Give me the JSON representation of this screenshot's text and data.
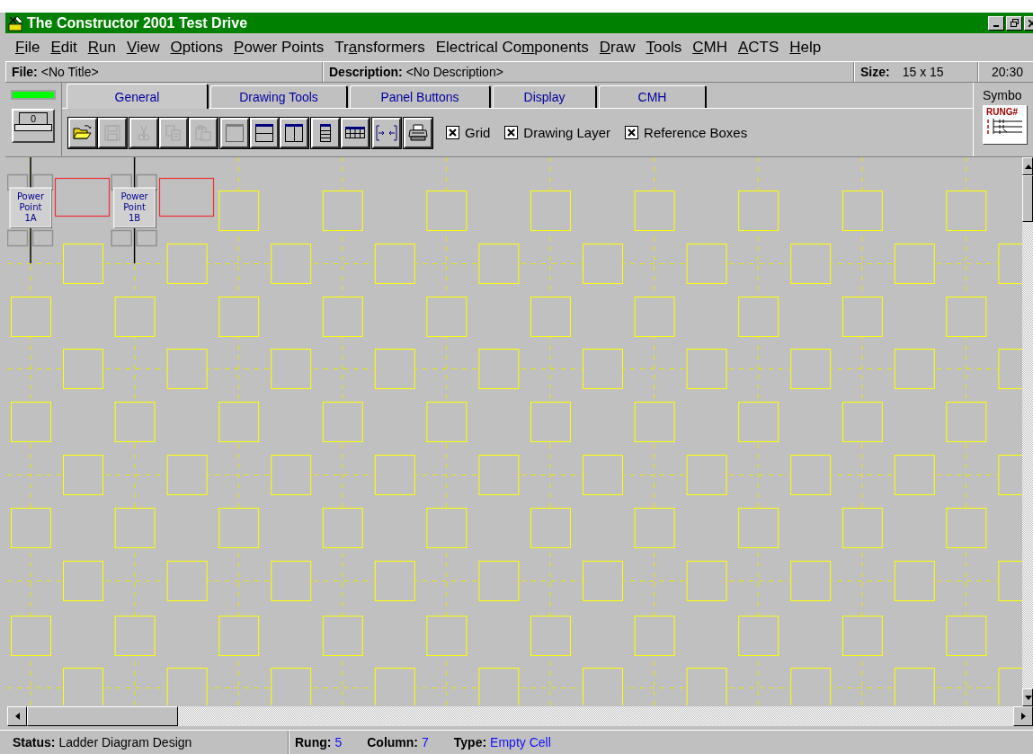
{
  "window": {
    "title": "The Constructor 2001 Test Drive"
  },
  "menu": [
    {
      "key": "F",
      "post": "ile"
    },
    {
      "key": "E",
      "post": "dit"
    },
    {
      "key": "R",
      "post": "un"
    },
    {
      "key": "V",
      "post": "iew"
    },
    {
      "key": "O",
      "post": "ptions"
    },
    {
      "key": "P",
      "post": "ower Points"
    },
    {
      "pre": "Tr",
      "key": "a",
      "post": "nsformers"
    },
    {
      "pre": "Electrical Co",
      "key": "m",
      "post": "ponents"
    },
    {
      "key": "D",
      "post": "raw"
    },
    {
      "key": "T",
      "post": "ools"
    },
    {
      "key": "C",
      "post": "MH"
    },
    {
      "key": "A",
      "post": "CTS"
    },
    {
      "key": "H",
      "post": "elp"
    }
  ],
  "info_bar": {
    "file_label": "File:",
    "file_value": "<No Title>",
    "description_label": "Description:",
    "description_value": "<No Description>",
    "size_label": "Size:",
    "size_value": "15 x 15",
    "time": "20:30"
  },
  "left_panel": {
    "indicator_on": true,
    "counter": "0"
  },
  "tabs": [
    {
      "label": "General",
      "selected": true
    },
    {
      "label": "Drawing Tools",
      "selected": false
    },
    {
      "label": "Panel Buttons",
      "selected": false
    },
    {
      "label": "Display",
      "selected": false
    },
    {
      "label": "CMH",
      "selected": false
    }
  ],
  "toolbar_groups": [
    [
      {
        "kind": "open",
        "disabled": false
      },
      {
        "kind": "save",
        "disabled": true
      }
    ],
    [
      {
        "kind": "cut",
        "disabled": true
      },
      {
        "kind": "copy",
        "disabled": true
      },
      {
        "kind": "paste",
        "disabled": true
      }
    ],
    [
      {
        "kind": "blank",
        "disabled": false
      },
      {
        "kind": "split-h",
        "disabled": false
      },
      {
        "kind": "split-v",
        "disabled": false
      }
    ],
    [
      {
        "kind": "rows",
        "disabled": false
      },
      {
        "kind": "table",
        "disabled": false
      }
    ],
    [
      {
        "kind": "fit",
        "disabled": false
      }
    ],
    [
      {
        "kind": "print",
        "disabled": false
      }
    ]
  ],
  "options": [
    {
      "label": "Grid",
      "checked": true
    },
    {
      "label": "Drawing Layer",
      "checked": true
    },
    {
      "label": "Reference Boxes",
      "checked": true
    }
  ],
  "symbols_panel": {
    "title": "Symbo",
    "icon_label": "RUNG#"
  },
  "canvas": {
    "power_points": [
      {
        "label": "Power Point 1A"
      },
      {
        "label": "Power Point 1B"
      }
    ]
  },
  "status_bar": {
    "status_label": "Status:",
    "status_value": "Ladder Diagram Design",
    "rung_label": "Rung:",
    "rung_value": "5",
    "column_label": "Column:",
    "column_value": "7",
    "type_label": "Type:",
    "type_value": "Empty Cell"
  }
}
